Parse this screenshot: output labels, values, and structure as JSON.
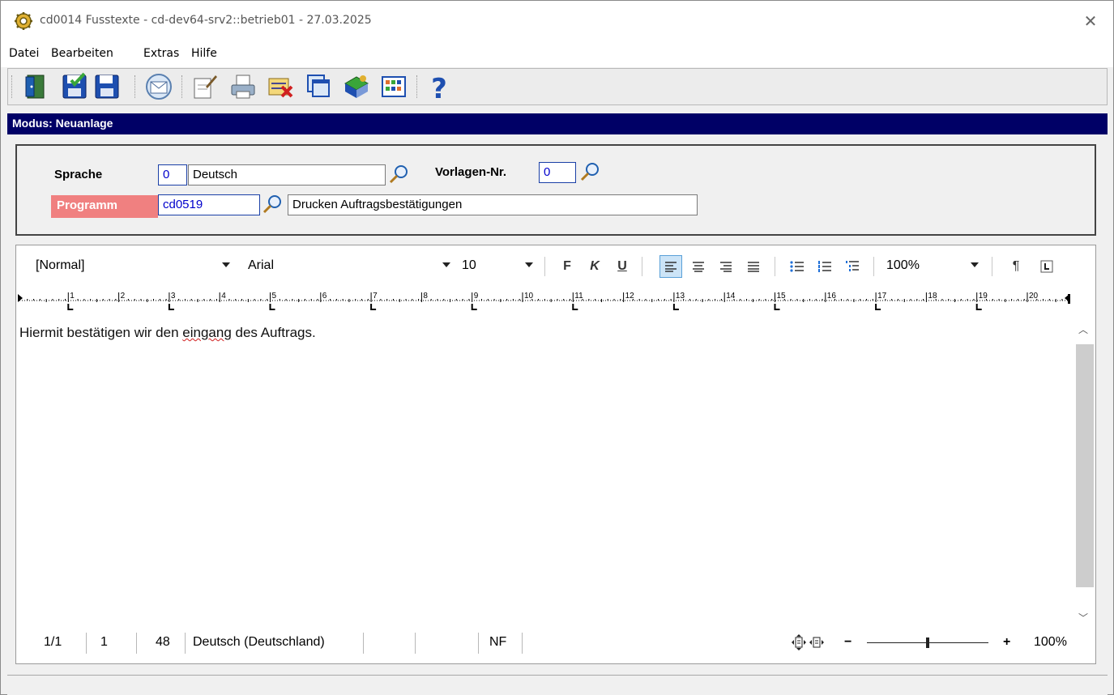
{
  "window": {
    "title": "cd0014 Fusstexte - cd-dev64-srv2::betrieb01 - 27.03.2025",
    "close_label": "✕"
  },
  "menu": [
    "Datei",
    "Bearbeiten",
    "Extras",
    "Hilfe"
  ],
  "toolbar_icons": [
    "exit-door-icon",
    "save-check-icon",
    "save-icon",
    "mail-icon",
    "edit-document-icon",
    "printer-icon",
    "delete-icon",
    "copy-windows-icon",
    "book-icon",
    "table-icon",
    "help-icon"
  ],
  "mode": "Modus: Neuanlage",
  "form": {
    "sprache_label": "Sprache",
    "sprache_code": "0",
    "sprache_name": "Deutsch",
    "vorlage_label": "Vorlagen-Nr.",
    "vorlage_value": "0",
    "programm_label": "Programm",
    "programm_code": "cd0519",
    "programm_desc": "Drucken Auftragsbestätigungen"
  },
  "format": {
    "style": "[Normal]",
    "font": "Arial",
    "size": "10",
    "bold": "F",
    "italic": "K",
    "underline": "U",
    "zoom": "100%",
    "pilcrow": "¶"
  },
  "ruler_numbers": [
    "1",
    "2",
    "3",
    "4",
    "5",
    "6",
    "7",
    "8",
    "9",
    "10",
    "11",
    "12",
    "13",
    "14",
    "15",
    "16",
    "17",
    "18",
    "19",
    "20"
  ],
  "document": {
    "pre": "Hiermit bestätigen wir den ",
    "misspelled": "eingang",
    "post": " des Auftrags."
  },
  "status": {
    "page": "1/1",
    "line": "1",
    "column": "48",
    "language": "Deutsch (Deutschland)",
    "mode": "NF",
    "zoom_minus": "−",
    "zoom_plus": "+",
    "zoom": "100%",
    "zoom_level": 0.5
  }
}
